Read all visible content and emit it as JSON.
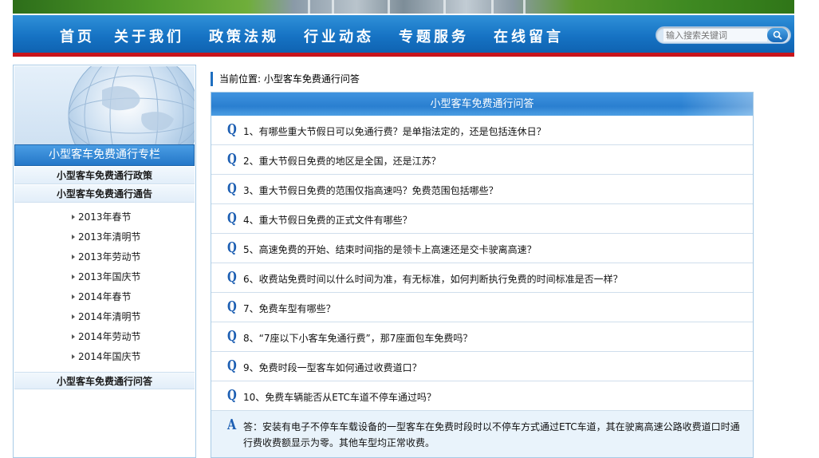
{
  "nav": {
    "items": [
      "首页",
      "关于我们",
      "政策法规",
      "行业动态",
      "专题服务",
      "在线留言"
    ],
    "search_placeholder": "输入搜索关键词"
  },
  "sidebar": {
    "title": "小型客车免费通行专栏",
    "menu": [
      "小型客车免费通行政策",
      "小型客车免费通行通告",
      "小型客车免费通行问答"
    ],
    "sub_items": [
      "2013年春节",
      "2013年清明节",
      "2013年劳动节",
      "2013年国庆节",
      "2014年春节",
      "2014年清明节",
      "2014年劳动节",
      "2014年国庆节"
    ]
  },
  "main": {
    "breadcrumb": "当前位置: 小型客车免费通行问答",
    "header": "小型客车免费通行问答",
    "q_mark": "Q",
    "a_mark": "A",
    "questions": [
      "1、有哪些重大节假日可以免通行费？是单指法定的，还是包括连休日？",
      "2、重大节假日免费的地区是全国，还是江苏？",
      "3、重大节假日免费的范围仅指高速吗？免费范围包括哪些？",
      "4、重大节假日免费的正式文件有哪些？",
      "5、高速免费的开始、结束时间指的是领卡上高速还是交卡驶离高速？",
      "6、收费站免费时间以什么时间为准，有无标准，如何判断执行免费的时间标准是否一样？",
      "7、免费车型有哪些？",
      "8、“7座以下小客车免通行费”，那7座面包车免费吗？",
      "9、免费时段一型客车如何通过收费道口？",
      "10、免费车辆能否从ETC车道不停车通过吗？"
    ],
    "answer": "答：安装有电子不停车车载设备的一型客车在免费时段时以不停车方式通过ETC车道，其在驶离高速公路收费道口时通行费收费额显示为零。其他车型均正常收费。"
  },
  "colors": {
    "nav_blue": "#1673c4",
    "accent_red": "#c8141b",
    "q_blue": "#1d5fb3"
  }
}
